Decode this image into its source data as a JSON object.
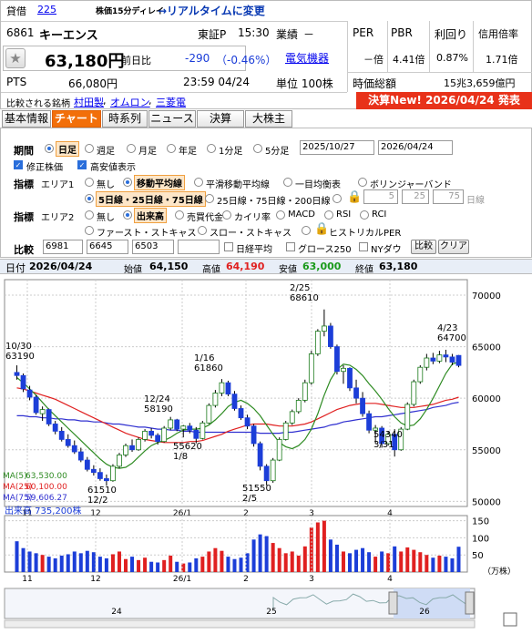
{
  "header": {
    "badge": "貸借",
    "id_link": "225",
    "delay_note": "株価15分ディレイ",
    "realtime_link": "→リアルタイムに変更",
    "code": "6861",
    "name": "キーエンス",
    "market": "東証P",
    "time": "15:30",
    "sector_label": "業績",
    "sector_dash": "－",
    "industry": "電気機器",
    "price": "63,180円",
    "prev_label": "前日比",
    "change": "-290",
    "change_pct": "（-0.46%）",
    "pts_label": "PTS",
    "pts_price": "66,080円",
    "pts_time": "23:59  04/24",
    "unit": "単位 100株",
    "compare_label": "比較される銘柄",
    "compare_items": [
      "村田製",
      "オムロン",
      "三菱電"
    ],
    "per_label": "PER",
    "per_value": "－倍",
    "pbr_label": "PBR",
    "pbr_value": "4.41倍",
    "yield_label": "利回り",
    "yield_value": "0.87%",
    "margin_label": "信用倍率",
    "margin_value": "1.71倍",
    "mcap_label": "時価総額",
    "mcap_value": "15兆3,659億円",
    "earnings": "決算New!  2026/04/24  発表"
  },
  "tabs": [
    "基本情報",
    "チャート",
    "時系列",
    "ニュース",
    "決算",
    "大株主"
  ],
  "panel": {
    "period_label": "期間",
    "periods": [
      "日足",
      "週足",
      "月足",
      "年足",
      "1分足",
      "5分足"
    ],
    "date_from": "2025/10/27",
    "date_to": "2026/04/24",
    "checks": [
      "修正株価",
      "高安値表示"
    ],
    "ind1_label": "指標",
    "area1": "エリア1",
    "ind1_opts": [
      "無し",
      "移動平均線",
      "平滑移動平均線",
      "一目均衡表",
      "ボリンジャーバンド"
    ],
    "ma_opts": [
      "5日線・25日線・75日線",
      "25日線・75日線・200日線"
    ],
    "ma_inputs": [
      "5",
      "25",
      "75"
    ],
    "ma_unit": "日線",
    "ind2_label": "指標",
    "area2": "エリア2",
    "ind2_opts": [
      "無し",
      "出来高",
      "売買代金",
      "カイリ率",
      "MACD",
      "RSI",
      "RCI"
    ],
    "ind2_opts_b": [
      "ファースト・ストキャス",
      "スロー・ストキャス",
      "ヒストリカルPER"
    ],
    "compare_label": "比較",
    "compare_codes": [
      "6981",
      "6645",
      "6503"
    ],
    "compare_checks": [
      "日経平均",
      "グロース250",
      "NYダウ"
    ],
    "compare_btn": "比較",
    "clear_btn": "クリア"
  },
  "ohlc": {
    "date_label": "日付",
    "date": "2026/04/24",
    "open_label": "始値",
    "open": "64,150",
    "high_label": "高値",
    "high": "64,190",
    "low_label": "安値",
    "low": "63,000",
    "close_label": "終値",
    "close": "63,180"
  },
  "chart_data": {
    "type": "candlestick",
    "y_ticks": [
      50000,
      55000,
      60000,
      65000,
      70000
    ],
    "ylim": [
      49500,
      71500
    ],
    "x_labels": [
      "11",
      "12",
      "26/1",
      "2",
      "3",
      "4"
    ],
    "annotations": [
      {
        "text": "10/30",
        "text2": "63190"
      },
      {
        "text": "12/24",
        "text2": "58190"
      },
      {
        "text": "1/16",
        "text2": "61860"
      },
      {
        "text": "2/25",
        "text2": "68610"
      },
      {
        "text": "4/23",
        "text2": "64700"
      },
      {
        "text": "61510",
        "text2": "12/2"
      },
      {
        "text": "55620",
        "text2": "1/8"
      },
      {
        "text": "51550",
        "text2": "2/5"
      },
      {
        "text": "54340",
        "text2": "3/31"
      }
    ],
    "ma_legend": [
      {
        "name": "MA(5)",
        "value": "63,530.00",
        "color": "#2e8b22"
      },
      {
        "name": "MA(25)",
        "value": "60,100.00",
        "color": "#e02020"
      },
      {
        "name": "MA(75)",
        "value": "59,606.27",
        "color": "#3030d0"
      }
    ],
    "candles": [
      [
        62500,
        63190,
        61800,
        62200
      ],
      [
        62200,
        62400,
        60600,
        60900
      ],
      [
        60800,
        61200,
        59800,
        60100
      ],
      [
        60100,
        60300,
        58400,
        58600
      ],
      [
        58500,
        59200,
        57800,
        58900
      ],
      [
        58900,
        59000,
        57300,
        57500
      ],
      [
        57500,
        57800,
        56500,
        56800
      ],
      [
        56800,
        57200,
        55800,
        56000
      ],
      [
        56000,
        56500,
        55200,
        55400
      ],
      [
        55400,
        55900,
        54600,
        54800
      ],
      [
        54800,
        55200,
        53800,
        54000
      ],
      [
        54000,
        54300,
        52900,
        53100
      ],
      [
        53100,
        53500,
        52500,
        52800
      ],
      [
        52800,
        53200,
        52000,
        52200
      ],
      [
        52200,
        52600,
        51510,
        52000
      ],
      [
        52000,
        53600,
        51900,
        53400
      ],
      [
        53400,
        54700,
        53200,
        54500
      ],
      [
        54500,
        55600,
        54300,
        55400
      ],
      [
        55400,
        56000,
        54800,
        55000
      ],
      [
        55000,
        56200,
        54900,
        56000
      ],
      [
        56000,
        57000,
        55800,
        56800
      ],
      [
        56800,
        57100,
        56100,
        56400
      ],
      [
        56400,
        56600,
        55500,
        55800
      ],
      [
        55800,
        57300,
        55700,
        57100
      ],
      [
        57100,
        58190,
        56900,
        57900
      ],
      [
        57900,
        58000,
        56800,
        57000
      ],
      [
        57000,
        57400,
        56200,
        57300
      ],
      [
        57300,
        57600,
        56600,
        56900
      ],
      [
        56900,
        57200,
        55620,
        56100
      ],
      [
        56100,
        57800,
        56000,
        57600
      ],
      [
        57600,
        59500,
        57500,
        59300
      ],
      [
        59300,
        60800,
        59100,
        60500
      ],
      [
        60500,
        61860,
        60200,
        61500
      ],
      [
        61500,
        61700,
        60200,
        60400
      ],
      [
        60400,
        60700,
        58800,
        59000
      ],
      [
        59000,
        59300,
        57900,
        58100
      ],
      [
        58100,
        58400,
        57000,
        57300
      ],
      [
        57300,
        57500,
        55300,
        55600
      ],
      [
        55600,
        55800,
        53000,
        53400
      ],
      [
        53400,
        53600,
        51550,
        52000
      ],
      [
        52000,
        54200,
        51800,
        54000
      ],
      [
        54000,
        56200,
        53900,
        56000
      ],
      [
        56000,
        57800,
        55900,
        57600
      ],
      [
        57600,
        58900,
        57400,
        58700
      ],
      [
        58700,
        60000,
        58500,
        59800
      ],
      [
        59800,
        61800,
        59600,
        61500
      ],
      [
        61500,
        64600,
        61300,
        64300
      ],
      [
        64300,
        66700,
        64100,
        66500
      ],
      [
        66500,
        68610,
        66000,
        67000
      ],
      [
        67000,
        67300,
        64800,
        65000
      ],
      [
        65000,
        65200,
        62300,
        62600
      ],
      [
        62600,
        63200,
        61400,
        62900
      ],
      [
        62900,
        63000,
        60700,
        61000
      ],
      [
        61000,
        61800,
        59500,
        60000
      ],
      [
        60000,
        60600,
        58200,
        58500
      ],
      [
        58500,
        58800,
        56600,
        56900
      ],
      [
        56900,
        57400,
        55600,
        57100
      ],
      [
        57100,
        57300,
        55200,
        55600
      ],
      [
        55600,
        56800,
        55400,
        56500
      ],
      [
        56500,
        57000,
        54340,
        55000
      ],
      [
        55000,
        57200,
        54900,
        57000
      ],
      [
        57000,
        59600,
        56900,
        59400
      ],
      [
        59400,
        61800,
        59200,
        61600
      ],
      [
        61600,
        63200,
        61400,
        63000
      ],
      [
        63000,
        64300,
        62700,
        63900
      ],
      [
        63900,
        64400,
        63300,
        63600
      ],
      [
        63600,
        64600,
        63400,
        64200
      ],
      [
        64200,
        64700,
        63500,
        64000
      ],
      [
        64000,
        64300,
        63200,
        63500
      ],
      [
        64150,
        64190,
        63000,
        63180
      ]
    ],
    "ma5": [
      62000,
      61500,
      60900,
      60300,
      59600,
      58900,
      58300,
      57700,
      57100,
      56500,
      55900,
      55300,
      54700,
      54100,
      53600,
      53300,
      53200,
      53300,
      53700,
      54300,
      54900,
      55400,
      55700,
      55900,
      56200,
      56600,
      56900,
      57000,
      57000,
      57100,
      57400,
      57900,
      58500,
      59200,
      59600,
      59800,
      59500,
      59000,
      58300,
      57400,
      56500,
      55700,
      55300,
      55100,
      55400,
      56000,
      57000,
      58500,
      60300,
      61800,
      62800,
      63300,
      63200,
      62800,
      62200,
      61400,
      60700,
      59900,
      59000,
      58200,
      57600,
      57300,
      57400,
      58000,
      58900,
      60000,
      61200,
      62400,
      63300,
      63530
    ],
    "ma25": [
      61000,
      60900,
      60700,
      60500,
      60300,
      60100,
      59900,
      59600,
      59300,
      59000,
      58700,
      58400,
      58100,
      57800,
      57500,
      57200,
      56900,
      56600,
      56400,
      56200,
      56000,
      55900,
      55800,
      55700,
      55700,
      55700,
      55700,
      55800,
      55800,
      55900,
      56100,
      56300,
      56500,
      56800,
      57000,
      57200,
      57400,
      57500,
      57500,
      57500,
      57400,
      57300,
      57300,
      57300,
      57400,
      57500,
      57700,
      58000,
      58300,
      58600,
      58900,
      59100,
      59300,
      59400,
      59500,
      59500,
      59500,
      59400,
      59300,
      59200,
      59100,
      59100,
      59100,
      59200,
      59300,
      59400,
      59600,
      59800,
      59900,
      60100
    ],
    "ma75": [
      58300,
      58300,
      58200,
      58200,
      58100,
      58100,
      58000,
      58000,
      57900,
      57900,
      57800,
      57800,
      57700,
      57700,
      57600,
      57500,
      57500,
      57400,
      57300,
      57200,
      57200,
      57100,
      57000,
      57000,
      56900,
      56900,
      56800,
      56800,
      56700,
      56700,
      56700,
      56700,
      56700,
      56700,
      56700,
      56700,
      56700,
      56700,
      56600,
      56600,
      56600,
      56600,
      56700,
      56700,
      56800,
      56900,
      57000,
      57100,
      57200,
      57400,
      57500,
      57700,
      57800,
      57900,
      58000,
      58100,
      58200,
      58200,
      58300,
      58400,
      58500,
      58600,
      58700,
      58800,
      58900,
      59100,
      59200,
      59300,
      59500,
      59606
    ],
    "volume_label": "出来高",
    "volume_value": "735,200株",
    "volume_unit": "（万株）",
    "volume_ticks": [
      50,
      100,
      150
    ],
    "volume": [
      90,
      70,
      60,
      55,
      50,
      45,
      40,
      48,
      52,
      60,
      55,
      62,
      58,
      45,
      40,
      52,
      60,
      38,
      45,
      35,
      42,
      30,
      28,
      35,
      48,
      30,
      25,
      28,
      40,
      45,
      60,
      70,
      62,
      45,
      38,
      42,
      55,
      95,
      110,
      105,
      85,
      70,
      55,
      60,
      48,
      75,
      130,
      145,
      150,
      95,
      80,
      60,
      55,
      65,
      70,
      58,
      45,
      60,
      55,
      75,
      60,
      72,
      65,
      58,
      50,
      42,
      48,
      45,
      40,
      74
    ],
    "timeline_labels": [
      "24",
      "25",
      "26"
    ]
  }
}
